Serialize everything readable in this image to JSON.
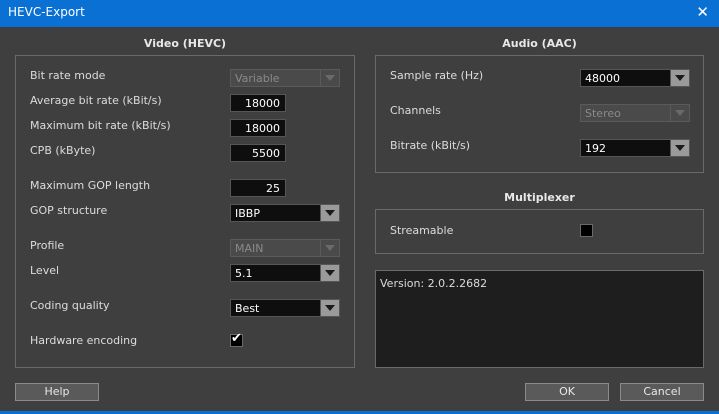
{
  "window": {
    "title": "HEVC-Export",
    "close_glyph": "✕"
  },
  "video": {
    "heading": "Video (HEVC)",
    "bit_rate_mode": {
      "label": "Bit rate mode",
      "value": "Variable"
    },
    "avg_bit_rate": {
      "label": "Average bit rate (kBit/s)",
      "value": "18000"
    },
    "max_bit_rate": {
      "label": "Maximum bit rate (kBit/s)",
      "value": "18000"
    },
    "cpb": {
      "label": "CPB (kByte)",
      "value": "5500"
    },
    "max_gop": {
      "label": "Maximum GOP length",
      "value": "25"
    },
    "gop_structure": {
      "label": "GOP structure",
      "value": "IBBP"
    },
    "profile": {
      "label": "Profile",
      "value": "MAIN"
    },
    "level": {
      "label": "Level",
      "value": "5.1"
    },
    "coding_quality": {
      "label": "Coding quality",
      "value": "Best"
    },
    "hardware_encoding": {
      "label": "Hardware encoding",
      "checked": true,
      "check_glyph": "✔"
    }
  },
  "audio": {
    "heading": "Audio (AAC)",
    "sample_rate": {
      "label": "Sample rate (Hz)",
      "value": "48000"
    },
    "channels": {
      "label": "Channels",
      "value": "Stereo"
    },
    "bitrate": {
      "label": "Bitrate (kBit/s)",
      "value": "192"
    }
  },
  "multiplexer": {
    "heading": "Multiplexer",
    "streamable": {
      "label": "Streamable",
      "checked": false
    }
  },
  "version_text": "Version: 2.0.2.2682",
  "buttons": {
    "help": "Help",
    "ok": "OK",
    "cancel": "Cancel"
  },
  "colors": {
    "titlebar": "#0a70d4",
    "background": "#3f3f3f",
    "field": "#0e0e0e"
  }
}
